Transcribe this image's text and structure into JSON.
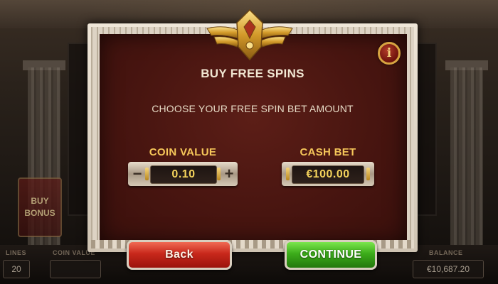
{
  "modal": {
    "title": "BUY FREE SPINS",
    "subtitle": "CHOOSE YOUR FREE SPIN BET AMOUNT",
    "info_icon": "i",
    "coin_value": {
      "label": "COIN VALUE",
      "value": "0.10",
      "decrease": "−",
      "increase": "+"
    },
    "cash_bet": {
      "label": "CASH BET",
      "value": "€100.00"
    },
    "back_label": "Back",
    "continue_label": "CONTINUE"
  },
  "background": {
    "buy_bonus_line1": "BUY",
    "buy_bonus_line2": "BONUS",
    "lines_label": "LINES",
    "lines_value": "20",
    "coin_value_label": "COIN VALUE",
    "balance_label": "BALANCE",
    "balance_value": "€10,687.20"
  },
  "colors": {
    "accent_gold": "#f6c75a",
    "modal_bg": "#481510",
    "back_button": "#c8281b",
    "continue_button": "#3cac1a"
  },
  "icons": [
    "winged-emblem-icon",
    "info-icon",
    "minus-icon",
    "plus-icon"
  ]
}
